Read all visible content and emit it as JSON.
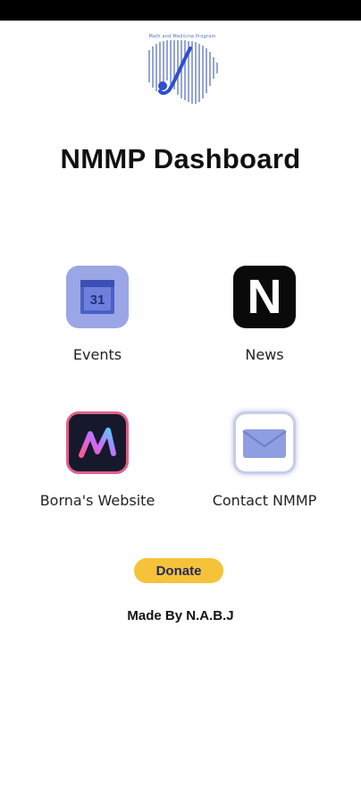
{
  "logo": {
    "caption": "Math and Medicine Program",
    "accent_color": "#3a5bd9"
  },
  "title": "NMMP Dashboard",
  "tiles": [
    {
      "label": "Events",
      "icon": "calendar-icon",
      "icon_text": "31",
      "color": "#9aa6e6"
    },
    {
      "label": "News",
      "icon": "news-icon",
      "icon_text": "N",
      "color": "#0a0a0a"
    },
    {
      "label": "Borna's Website",
      "icon": "website-logo-icon",
      "color": "#16192b"
    },
    {
      "label": "Contact NMMP",
      "icon": "mail-icon",
      "color": "#8f9ee0"
    }
  ],
  "donate": {
    "label": "Donate",
    "color": "#f6c23a"
  },
  "footer": "Made By N.A.B.J"
}
